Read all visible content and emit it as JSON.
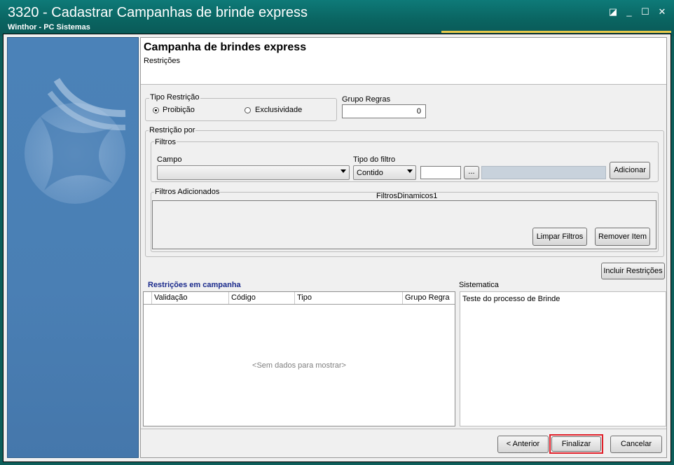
{
  "window": {
    "title": "3320 - Cadastrar Campanhas de brinde express",
    "subtitle": "Winthor - PC Sistemas",
    "controls": {
      "restore": "◪",
      "minimize": "_",
      "maximize": "☐",
      "close": "✕"
    }
  },
  "header": {
    "title": "Campanha de brindes express",
    "subtitle": "Restrições"
  },
  "tipo_restricao": {
    "legend": "Tipo Restrição",
    "options": [
      {
        "label": "Proibição",
        "selected": true
      },
      {
        "label": "Exclusividade",
        "selected": false
      }
    ]
  },
  "grupo_regras": {
    "label": "Grupo Regras",
    "value": "0"
  },
  "restricao_por": {
    "legend": "Restrição por",
    "filtros": {
      "legend": "Filtros",
      "campo_label": "Campo",
      "campo_value": "",
      "tipo_filtro_label": "Tipo do filtro",
      "tipo_filtro_value": "Contido",
      "valor_value": "",
      "ellipsis_label": "...",
      "add_button": "Adicionar"
    },
    "filtros_adicionados": {
      "legend": "Filtros Adicionados",
      "component_name": "FiltrosDinamicos1",
      "clear_button": "Limpar Filtros",
      "remove_button": "Remover Item"
    }
  },
  "incluir_button": "Incluir Restrições",
  "restricoes": {
    "title": "Restrições em campanha",
    "columns": [
      "Validação",
      "Código",
      "Tipo",
      "Grupo Regra"
    ],
    "empty_text": "<Sem dados para mostrar>"
  },
  "sistematica": {
    "label": "Sistematica",
    "text": "Teste do processo de Brinde"
  },
  "footer": {
    "back_button": "< Anterior",
    "finish_button": "Finalizar",
    "cancel_button": "Cancelar",
    "highlight_color": "#e0202a"
  },
  "colors": {
    "titlebar": "#0a6461",
    "sidebar": "#4a7fb4",
    "section_title": "#1a2a8c"
  }
}
